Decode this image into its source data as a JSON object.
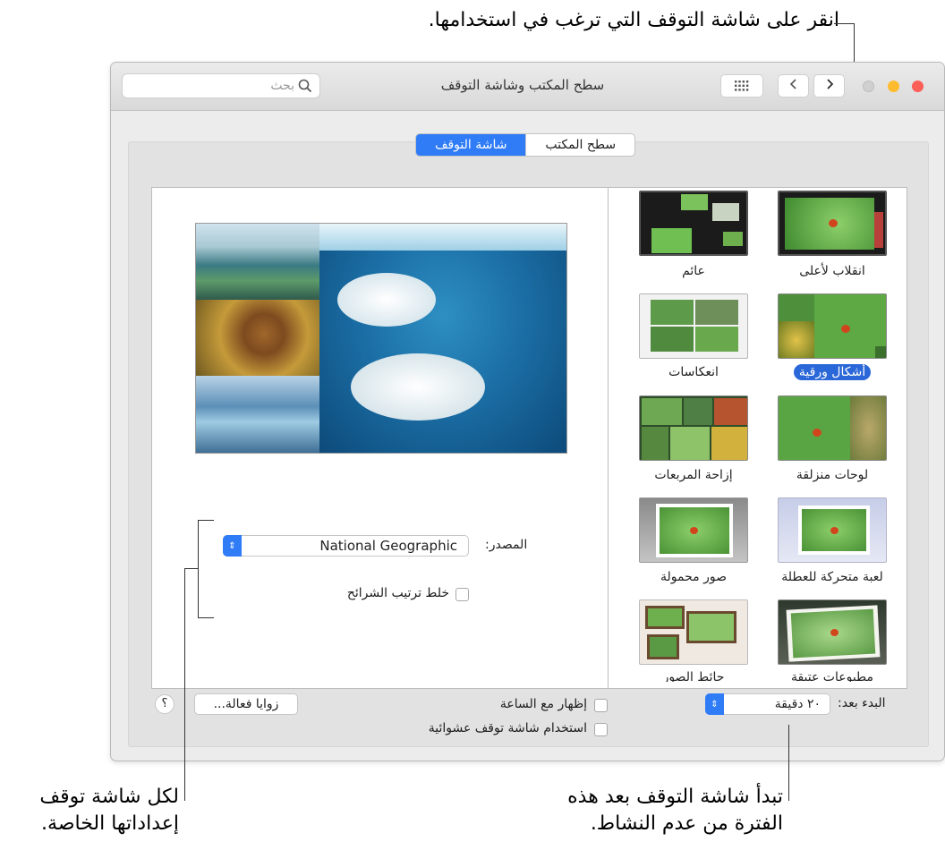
{
  "callouts": {
    "top": "انقر على شاشة التوقف التي ترغب في استخدامها.",
    "left_line1": "لكل شاشة توقف",
    "left_line2": "إعداداتها الخاصة.",
    "bottom_line1": "تبدأ شاشة التوقف بعد هذه",
    "bottom_line2": "الفترة من عدم النشاط."
  },
  "window": {
    "title": "سطح المكتب وشاشة التوقف",
    "search_placeholder": "بحث",
    "grid_icon": "grid-icon",
    "back_icon": "‹",
    "forward_icon": "›"
  },
  "tabs": {
    "desktop": "سطح المكتب",
    "screensaver": "شاشة التوقف"
  },
  "savers": [
    {
      "label": "انقلاب لأعلى"
    },
    {
      "label": "عائم"
    },
    {
      "label": "أشكال ورقية"
    },
    {
      "label": "انعكاسات"
    },
    {
      "label": "لوحات منزلقة"
    },
    {
      "label": "إزاحة المربعات"
    },
    {
      "label": "لعبة متحركة للعطلة"
    },
    {
      "label": "صور محمولة"
    },
    {
      "label": "مطبوعات عتيقة"
    },
    {
      "label": "حائط الصور"
    }
  ],
  "selected_saver": "أشكال ورقية",
  "options": {
    "source_label": "المصدر:",
    "source_value": "National Geographic",
    "shuffle_label": "خلط ترتيب الشرائح"
  },
  "bottom": {
    "start_after_label": "البدء بعد:",
    "start_after_value": "٢٠ دقيقة",
    "show_clock": "إظهار مع الساعة",
    "random_saver": "استخدام شاشة توقف عشوائية",
    "hot_corners": "زوايا فعالة...",
    "help": "؟"
  },
  "colors": {
    "accent": "#2a67d8",
    "close": "#fc5f57",
    "minimize": "#fdbc2e",
    "zoom_disabled": "#d0d0d0"
  }
}
